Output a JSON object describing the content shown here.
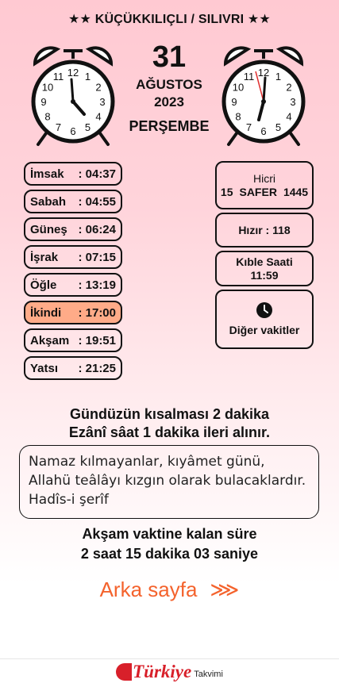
{
  "header": {
    "location": "★★ KÜÇÜKKILIÇLI / SILIVRI ★★"
  },
  "date": {
    "day": "31",
    "month": "AĞUSTOS",
    "year": "2023",
    "weekday": "PERŞEMBE"
  },
  "clock_numbers": [
    "12",
    "1",
    "2",
    "3",
    "4",
    "5",
    "6",
    "7",
    "8",
    "9",
    "10",
    "11"
  ],
  "times": [
    {
      "name": "İmsak",
      "value": ": 04:37",
      "active": false
    },
    {
      "name": "Sabah",
      "value": ": 04:55",
      "active": false
    },
    {
      "name": "Güneş",
      "value": ": 06:24",
      "active": false
    },
    {
      "name": "İşrak",
      "value": ": 07:15",
      "active": false
    },
    {
      "name": "Öğle",
      "value": ": 13:19",
      "active": false
    },
    {
      "name": "İkindi",
      "value": ": 17:00",
      "active": true
    },
    {
      "name": "Akşam",
      "value": ": 19:51",
      "active": false
    },
    {
      "name": "Yatsı",
      "value": ": 21:25",
      "active": false
    }
  ],
  "hicri": {
    "title": "Hicri",
    "day": "15",
    "month": "SAFER",
    "year": "1445"
  },
  "hizir": {
    "label": "Hızır : 118"
  },
  "kible": {
    "title": "Kıble Saati",
    "time": "11:59"
  },
  "diger": {
    "label": "Diğer vakitler",
    "icon": "clock-icon"
  },
  "info": {
    "line1": "Gündüzün kısalması 2 dakika",
    "line2": "Ezânî sâat 1 dakika ileri alınır."
  },
  "hadis": {
    "text": "Namaz kılmayanlar, kıyâmet günü, Allahü teâlâyı kızgın olarak bulacaklardır. Hadîs-i şerîf"
  },
  "remaining": {
    "line1": "Akşam vaktine kalan süre",
    "line2": "2 saat 15 dakika 03 saniye"
  },
  "back": {
    "label": "Arka sayfa",
    "arrow": "⋙"
  },
  "brand": {
    "name": "Türkiye",
    "sub": "Takvimi"
  },
  "colors": {
    "accent": "#f4632d",
    "active_row": "#ffab88",
    "brand": "#d8202a"
  }
}
